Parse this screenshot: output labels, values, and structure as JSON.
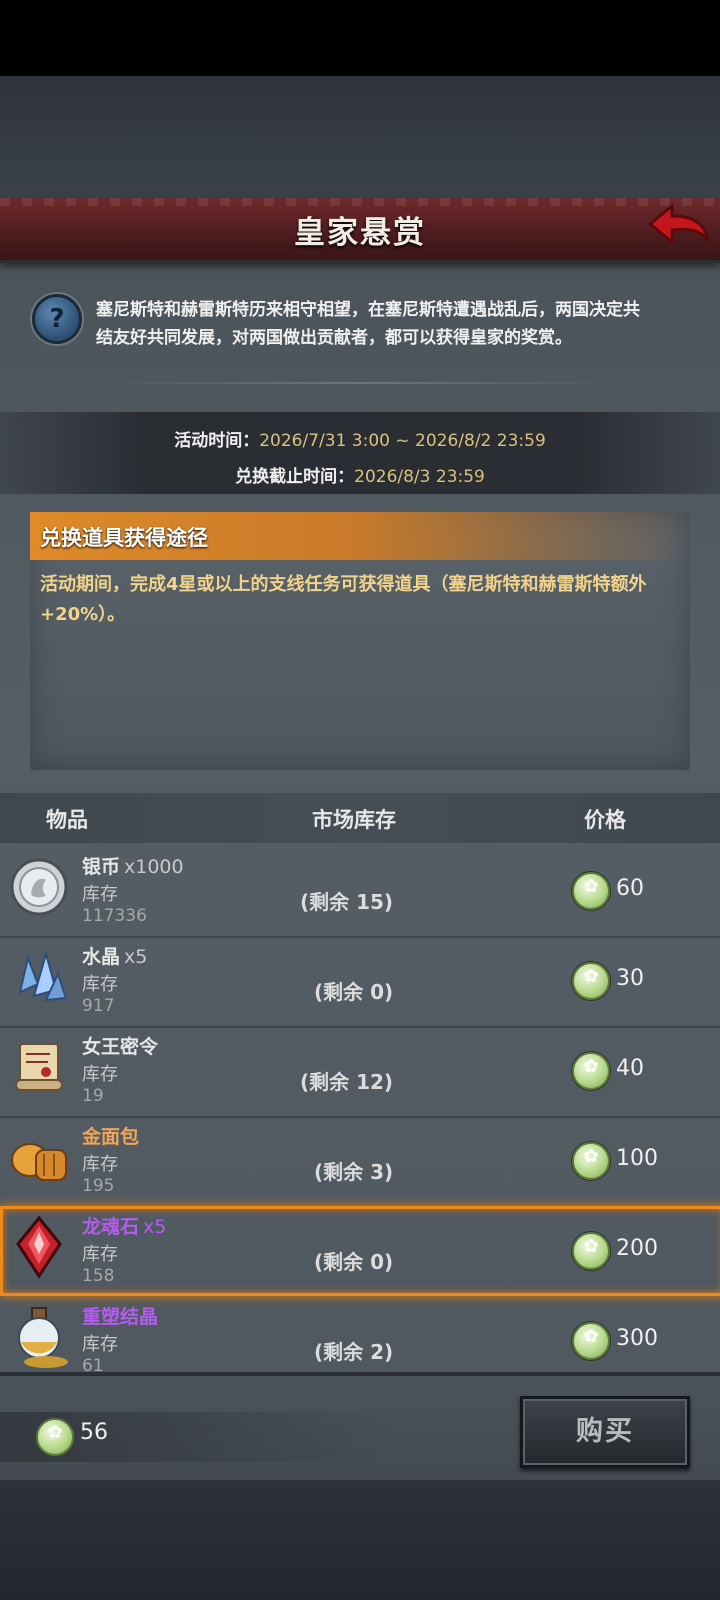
{
  "header": {
    "title": "皇家悬赏"
  },
  "intro": {
    "text": "塞尼斯特和赫雷斯特历来相守相望，在塞尼斯特遭遇战乱后，两国决定共结友好共同发展，对两国做出贡献者，都可以获得皇家的奖赏。"
  },
  "times": {
    "event_label": "活动时间：",
    "event_value": "2026/7/31 3:00 ~ 2026/8/2 23:59",
    "deadline_label": "兑换截止时间：",
    "deadline_value": "2026/8/3 23:59"
  },
  "info": {
    "title": "兑换道具获得途径",
    "body": "活动期间，完成4星或以上的支线任务可获得道具（塞尼斯特和赫雷斯特额外+20%）。"
  },
  "table": {
    "col_item": "物品",
    "col_stock": "市场库存",
    "col_price": "价格"
  },
  "items": [
    {
      "name": "银币",
      "qty": "x1000",
      "stock_label": "库存",
      "stock": "117336",
      "remain": "(剩余 15)",
      "price": "60",
      "icon": "silver-coin-icon",
      "color": "#ffffff"
    },
    {
      "name": "水晶",
      "qty": "x5",
      "stock_label": "库存",
      "stock": "917",
      "remain": "(剩余 0)",
      "price": "30",
      "icon": "crystal-icon",
      "color": "#ffffff"
    },
    {
      "name": "女王密令",
      "qty": "",
      "stock_label": "库存",
      "stock": "19",
      "remain": "(剩余 12)",
      "price": "40",
      "icon": "scroll-icon",
      "color": "#ffffff"
    },
    {
      "name": "金面包",
      "qty": "",
      "stock_label": "库存",
      "stock": "195",
      "remain": "(剩余 3)",
      "price": "100",
      "icon": "bread-icon",
      "color": "#f0a45a"
    },
    {
      "name": "龙魂石",
      "qty": "x5",
      "stock_label": "库存",
      "stock": "158",
      "remain": "(剩余 0)",
      "price": "200",
      "icon": "dragon-soul-stone-icon",
      "color": "#b45cf0"
    },
    {
      "name": "重塑结晶",
      "qty": "",
      "stock_label": "库存",
      "stock": "61",
      "remain": "(剩余 2)",
      "price": "300",
      "icon": "potion-icon",
      "color": "#b45cf0"
    }
  ],
  "footer": {
    "currency_amount": "56",
    "buy_label": "购买"
  }
}
